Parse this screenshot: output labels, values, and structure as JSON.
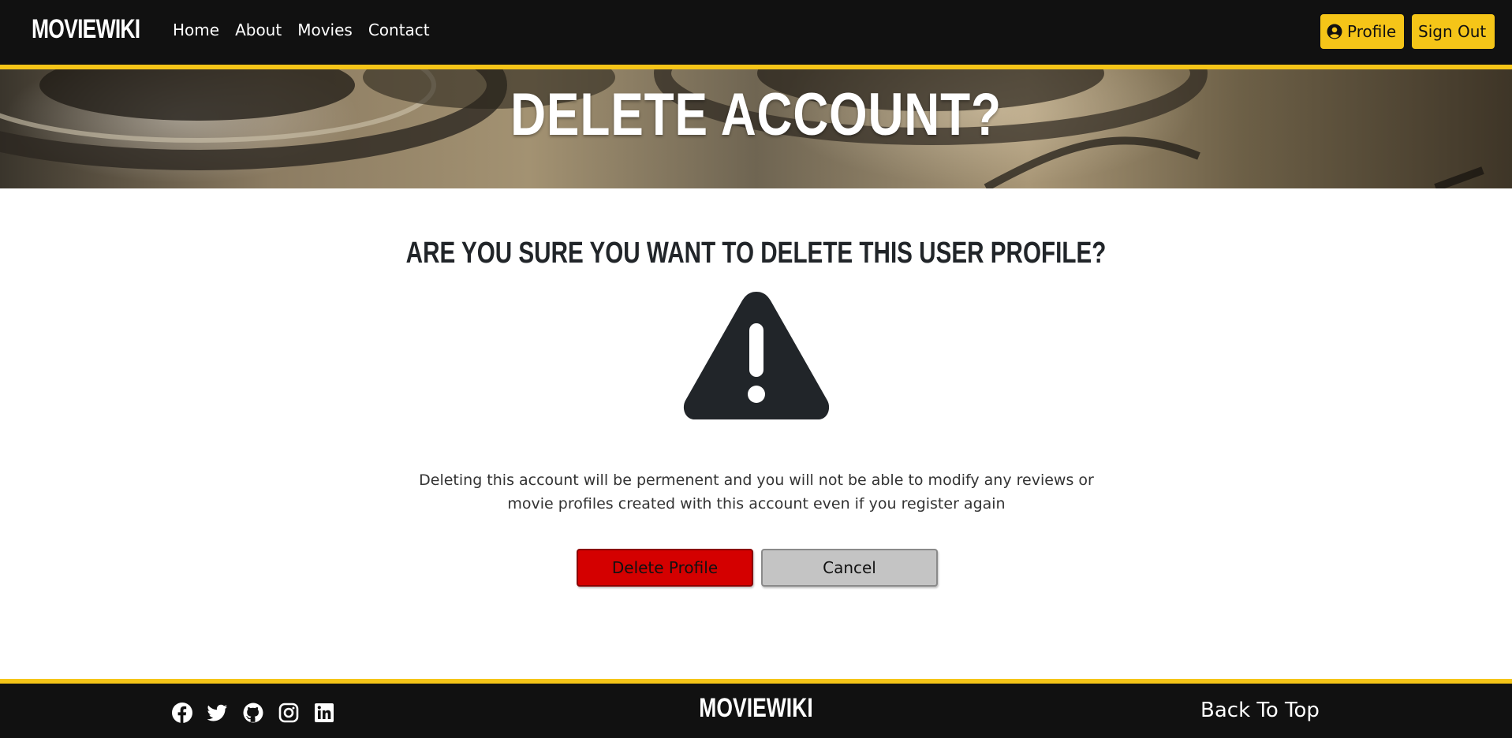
{
  "navbar": {
    "brand": "MOVIEWIKI",
    "links": [
      "Home",
      "About",
      "Movies",
      "Contact"
    ],
    "profile_label": "Profile",
    "signout_label": "Sign Out",
    "accent_color": "#f5c518",
    "background_color": "#111111"
  },
  "hero": {
    "title": "DELETE ACCOUNT?"
  },
  "main": {
    "question": "ARE YOU SURE YOU WANT TO DELETE THIS USER PROFILE?",
    "icon": "exclamation-triangle-icon",
    "warning_text": "Deleting this account will be permenent and you will not be able to modify any reviews or movie profiles created with this account even if you register again",
    "delete_label": "Delete Profile",
    "cancel_label": "Cancel",
    "delete_color": "#d40000",
    "cancel_color": "#c4c4c4"
  },
  "footer": {
    "social_icons": [
      "facebook-icon",
      "twitter-icon",
      "github-icon",
      "instagram-icon",
      "linkedin-icon"
    ],
    "brand": "MOVIEWIKI",
    "back_to_top": "Back To Top"
  }
}
